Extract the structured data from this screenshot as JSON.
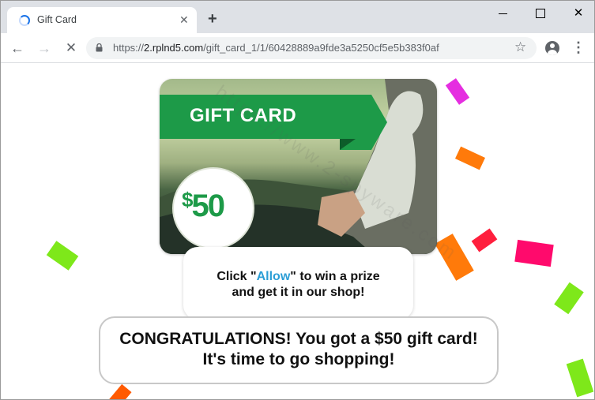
{
  "browser": {
    "tab": {
      "title": "Gift Card",
      "close": "✕"
    },
    "new_tab": "+",
    "window_controls": {
      "close": "✕"
    },
    "nav": {
      "back": "←",
      "forward": "→",
      "stop": "✕"
    },
    "url": {
      "prefix": "https://",
      "host": "2.rplnd5.com",
      "path": "/gift_card_1/1/60428889a9fde3a5250cf5e5b383f0af"
    },
    "star": "☆",
    "menu": "⋮",
    "icons": [
      "loading-spinner-icon",
      "close-icon",
      "plus-icon",
      "back-icon",
      "forward-icon",
      "stop-icon",
      "lock-icon",
      "star-icon",
      "profile-icon",
      "menu-icon"
    ]
  },
  "page": {
    "card": {
      "title": "GIFT CARD",
      "amount_currency": "$",
      "amount_value": "50",
      "brand_color": "#1d9a48"
    },
    "prompt": {
      "text_before": "Click \"",
      "allow": "Allow",
      "text_after": "\" to win a prize",
      "line2": "and get it in our shop!",
      "allow_color": "#2c9ed6"
    },
    "congrats": {
      "line1": "CONGRATULATIONS! You got a $50 gift card!",
      "line2": "It's time to go shopping!"
    },
    "watermark": "https://www.2-spyware.com",
    "confetti_colors": [
      "#e52ee0",
      "#ff7a0a",
      "#ff1f3d",
      "#ff0a6c",
      "#7ee81a",
      "#ff5a00"
    ]
  }
}
